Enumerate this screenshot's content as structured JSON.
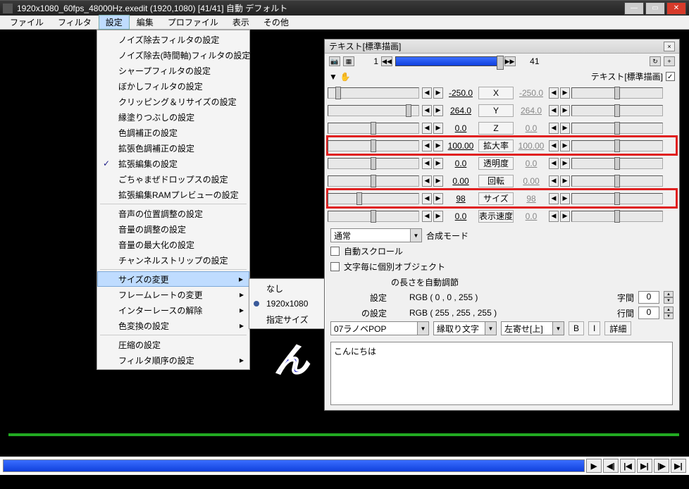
{
  "title": "1920x1080_60fps_48000Hz.exedit (1920,1080)  [41/41]  自動  デフォルト",
  "menu": {
    "file": "ファイル",
    "filter": "フィルタ",
    "settings": "設定",
    "edit": "編集",
    "profile": "プロファイル",
    "view": "表示",
    "other": "その他"
  },
  "settings_menu": {
    "items1": [
      "ノイズ除去フィルタの設定",
      "ノイズ除去(時間軸)フィルタの設定",
      "シャープフィルタの設定",
      "ぼかしフィルタの設定",
      "クリッピング＆リサイズの設定",
      "縁塗りつぶしの設定",
      "色調補正の設定",
      "拡張色調補正の設定",
      "拡張編集の設定",
      "ごちゃまぜドロップスの設定",
      "拡張編集RAMプレビューの設定"
    ],
    "items2": [
      "音声の位置調整の設定",
      "音量の調整の設定",
      "音量の最大化の設定",
      "チャンネルストリップの設定"
    ],
    "items3": [
      "サイズの変更",
      "フレームレートの変更",
      "インターレースの解除",
      "色変換の設定"
    ],
    "items4": [
      "圧縮の設定",
      "フィルタ順序の設定"
    ],
    "checked_index": 8
  },
  "size_submenu": {
    "none": "なし",
    "preset": "1920x1080",
    "custom": "指定サイズ"
  },
  "panel": {
    "title": "テキスト[標準描画]",
    "frame_start": "1",
    "frame_end": "41",
    "obj_label": "テキスト[標準描画]",
    "params": [
      {
        "val": "-250.0",
        "label": "X",
        "val2": "-250.0"
      },
      {
        "val": "264.0",
        "label": "Y",
        "val2": "264.0"
      },
      {
        "val": "0.0",
        "label": "Z",
        "val2": "0.0"
      },
      {
        "val": "100.00",
        "label": "拡大率",
        "val2": "100.00",
        "red": true
      },
      {
        "val": "0.0",
        "label": "透明度",
        "val2": "0.0"
      },
      {
        "val": "0.00",
        "label": "回転",
        "val2": "0.00"
      },
      {
        "val": "98",
        "label": "サイズ",
        "val2": "98",
        "red": true
      },
      {
        "val": "0.0",
        "label": "表示速度",
        "val2": "0.0"
      }
    ],
    "blend_mode": "通常",
    "blend_label": "合成モード",
    "auto_scroll": "自動スクロール",
    "per_char": "文字毎に個別オブジェクト",
    "auto_len_suffix": "の長さを自動調節",
    "setting_suffix1": "設定",
    "setting_suffix2": "の設定",
    "rgb1": "RGB ( 0 , 0 , 255 )",
    "rgb2": "RGB ( 255 , 255 , 255 )",
    "spacing_label": "字間",
    "spacing_val": "0",
    "line_label": "行間",
    "line_val": "0",
    "font": "07ラノベPOP",
    "deco": "縁取り文字",
    "align": "左寄せ[上]",
    "b": "B",
    "i": "I",
    "detail": "詳細",
    "text": "こんにちは"
  },
  "preview_text": "ん",
  "playback": {
    "play": "▶",
    "prev_kf": "◀|",
    "prev": "|◀",
    "next": "▶|",
    "next_kf": "|▶",
    "end": "▶|"
  }
}
